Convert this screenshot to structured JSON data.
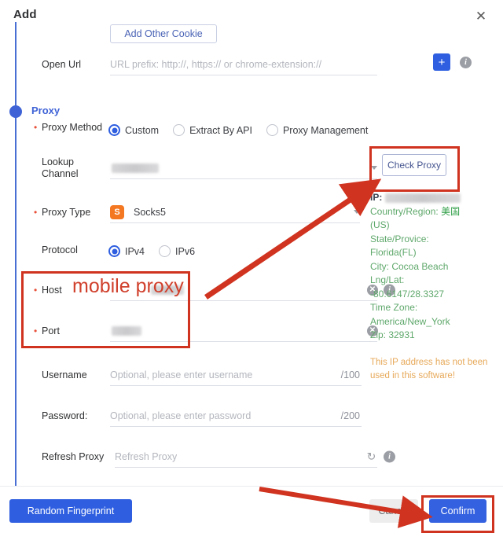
{
  "dialog": {
    "title": "Add",
    "close_icon": "close-icon"
  },
  "cookie": {
    "add_other_cookie_label": "Add Other Cookie"
  },
  "open_url": {
    "label": "Open Url",
    "placeholder": "URL prefix: http://, https:// or chrome-extension://",
    "add_label": "+"
  },
  "proxy_section": {
    "title": "Proxy",
    "method": {
      "label": "Proxy Method",
      "options": [
        {
          "label": "Custom",
          "selected": true
        },
        {
          "label": "Extract By API",
          "selected": false
        },
        {
          "label": "Proxy Management",
          "selected": false
        }
      ]
    },
    "lookup_channel": {
      "label_line1": "Lookup",
      "label_line2": "Channel",
      "value": ""
    },
    "check_proxy_label": "Check Proxy",
    "proxy_type": {
      "label": "Proxy Type",
      "value": "Socks5",
      "badge": "S",
      "badge_color": "#f47721"
    },
    "protocol": {
      "label": "Protocol",
      "options": [
        {
          "label": "IPv4",
          "selected": true
        },
        {
          "label": "IPv6",
          "selected": false
        }
      ]
    },
    "host": {
      "label": "Host",
      "value": ""
    },
    "port": {
      "label": "Port",
      "value": ""
    },
    "username": {
      "label": "Username",
      "placeholder": "Optional, please enter username",
      "counter": "/100"
    },
    "password": {
      "label": "Password:",
      "placeholder": "Optional, please enter password",
      "counter": "/200"
    },
    "refresh_proxy": {
      "label": "Refresh Proxy",
      "placeholder": "Refresh Proxy"
    }
  },
  "ip_info": {
    "ip_label": "IP:",
    "ip_value": "",
    "country_label": "Country/Region:",
    "country_value": "美国",
    "country_value2": "(US)",
    "state_label": "State/Provice:",
    "state_value": "Florida(FL)",
    "city_line": "City: Cocoa Beach",
    "lnglat_label": "Lng/Lat:",
    "lnglat_value": "-80.6147/28.3327",
    "timezone_label": "Time Zone:",
    "timezone_value": "America/New_York",
    "zip_line": "Zip: 32931",
    "warning": "This IP address has not been used in this software!"
  },
  "footer": {
    "random_fingerprint_label": "Random Fingerprint",
    "cancel_label": "Cancel",
    "confirm_label": "Confirm"
  },
  "annotations": {
    "host_note": "mobile proxy",
    "accent_red": "#d0331f",
    "accent_blue": "#2f5fe0",
    "accent_green": "#5fa86b",
    "accent_orange": "#e7a95a"
  }
}
